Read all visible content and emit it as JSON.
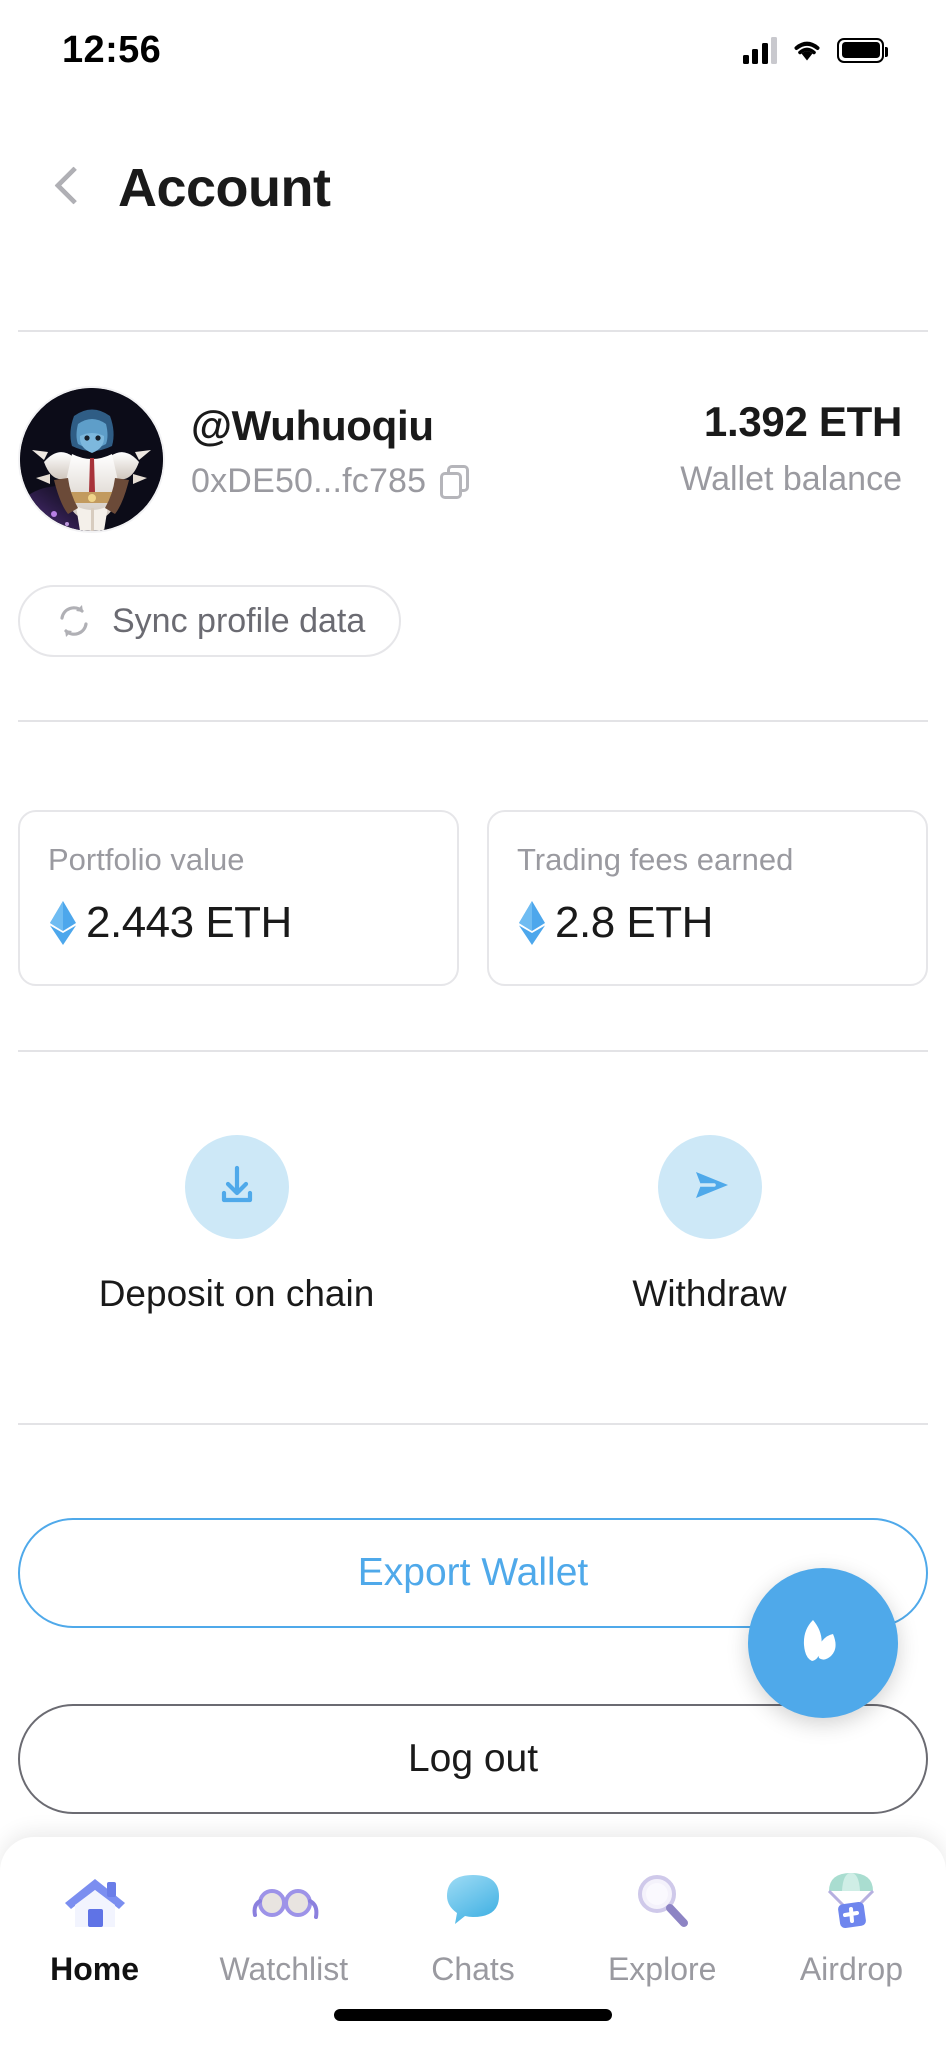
{
  "status_bar": {
    "time": "12:56",
    "cellular_icon": "signal-bars-icon",
    "wifi_icon": "wifi-icon",
    "battery_icon": "battery-full-icon"
  },
  "header": {
    "back_icon": "chevron-left-icon",
    "title": "Account"
  },
  "profile": {
    "avatar_alt": "armored-fantasy-character-avatar",
    "username": "@Wuhuoqiu",
    "address": "0xDE50...fc785",
    "copy_icon": "copy-icon",
    "balance_value": "1.392 ETH",
    "balance_label": "Wallet balance"
  },
  "sync": {
    "icon": "refresh-cycle-icon",
    "label": "Sync profile data"
  },
  "stats": [
    {
      "label": "Portfolio value",
      "value": "2.443 ETH",
      "icon": "ethereum-icon"
    },
    {
      "label": "Trading fees earned",
      "value": "2.8 ETH",
      "icon": "ethereum-icon"
    }
  ],
  "actions": [
    {
      "label": "Deposit on chain",
      "icon": "download-tray-icon"
    },
    {
      "label": "Withdraw",
      "icon": "send-plane-icon"
    }
  ],
  "buttons": {
    "export_wallet": "Export Wallet",
    "log_out": "Log out"
  },
  "fab": {
    "icon": "leaf-petals-logo-icon"
  },
  "bottom_nav": {
    "items": [
      {
        "label": "Home",
        "icon": "house-icon",
        "active": true
      },
      {
        "label": "Watchlist",
        "icon": "glasses-icon",
        "active": false
      },
      {
        "label": "Chats",
        "icon": "speech-bubble-icon",
        "active": false
      },
      {
        "label": "Explore",
        "icon": "magnifying-glass-icon",
        "active": false
      },
      {
        "label": "Airdrop",
        "icon": "parachute-box-icon",
        "active": false
      }
    ]
  },
  "colors": {
    "accent": "#4fa9ea",
    "accent_soft": "#cde8f7",
    "muted_text": "#9a9aa0",
    "primary_text": "#1a1a1a",
    "divider": "#e3e3e6"
  }
}
